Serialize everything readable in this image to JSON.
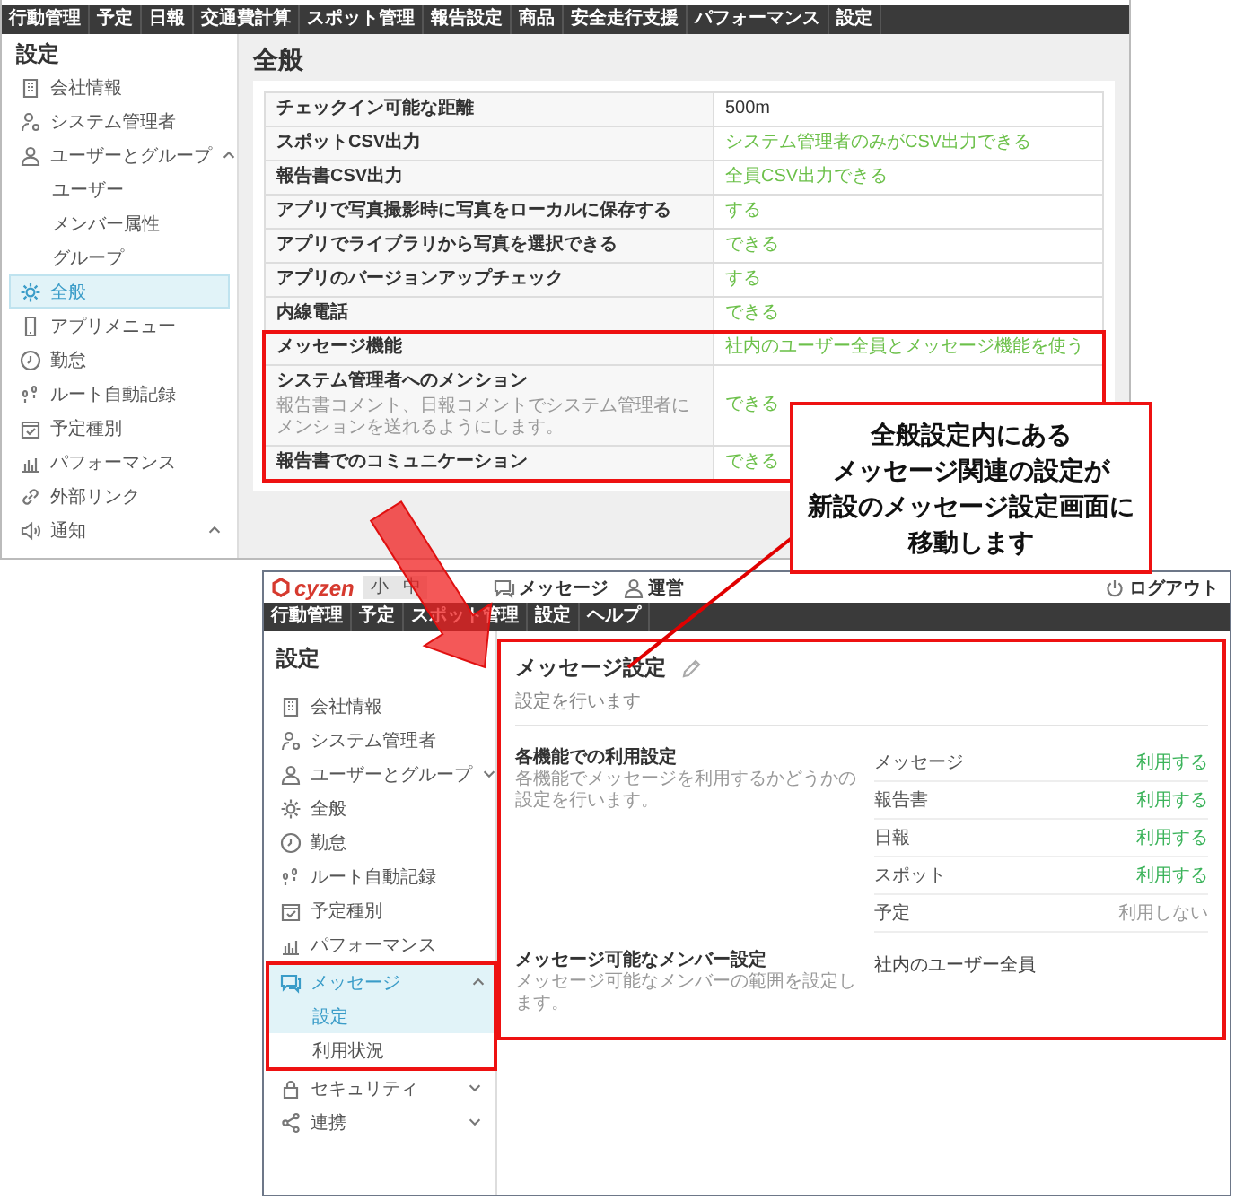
{
  "old_window": {
    "nav_tabs": [
      "行動管理",
      "予定",
      "日報",
      "交通費計算",
      "スポット管理",
      "報告設定",
      "商品",
      "安全走行支援",
      "パフォーマンス",
      "設定"
    ],
    "sidebar": {
      "title": "設定",
      "items": [
        {
          "label": "会社情報",
          "selected": false
        },
        {
          "label": "システム管理者",
          "selected": false
        },
        {
          "label": "ユーザーとグループ",
          "selected": false,
          "expanded": true,
          "children": [
            {
              "label": "ユーザー"
            },
            {
              "label": "メンバー属性"
            },
            {
              "label": "グループ"
            }
          ]
        },
        {
          "label": "全般",
          "selected": true
        },
        {
          "label": "アプリメニュー",
          "selected": false
        },
        {
          "label": "勤怠",
          "selected": false
        },
        {
          "label": "ルート自動記録",
          "selected": false
        },
        {
          "label": "予定種別",
          "selected": false
        },
        {
          "label": "パフォーマンス",
          "selected": false
        },
        {
          "label": "外部リンク",
          "selected": false
        },
        {
          "label": "通知",
          "selected": false,
          "expanded": true
        }
      ]
    },
    "page_title": "全般",
    "table": {
      "rows": [
        {
          "label": "チェックイン可能な距離",
          "value": "500m",
          "color": "#333333"
        },
        {
          "label": "スポットCSV出力",
          "value": "システム管理者のみがCSV出力できる",
          "color": "#6cc04a"
        },
        {
          "label": "報告書CSV出力",
          "value": "全員CSV出力できる",
          "color": "#6cc04a"
        },
        {
          "label": "アプリで写真撮影時に写真をローカルに保存する",
          "value": "する",
          "color": "#6cc04a"
        },
        {
          "label": "アプリでライブラリから写真を選択できる",
          "value": "できる",
          "color": "#6cc04a"
        },
        {
          "label": "アプリのバージョンアップチェック",
          "value": "する",
          "color": "#6cc04a"
        },
        {
          "label": "内線電話",
          "value": "できる",
          "color": "#6cc04a"
        }
      ],
      "highlighted_rows": [
        {
          "label": "メッセージ機能",
          "value": "社内のユーザー全員とメッセージ機能を使う",
          "color": "#6cc04a"
        },
        {
          "label": "システム管理者へのメンション",
          "note": "報告書コメント、日報コメントでシステム管理者にメンションを送れるようにします。",
          "value": "できる",
          "color": "#6cc04a"
        },
        {
          "label": "報告書でのコミュニケーション",
          "value": "できる",
          "color": "#6cc04a"
        }
      ]
    }
  },
  "callout": {
    "lines": [
      "全般設定内にある",
      "メッセージ関連の設定が",
      "新設のメッセージ設定画面に",
      "移動します"
    ]
  },
  "new_window": {
    "logo": "cyzen",
    "font_size_buttons": [
      "小",
      "中"
    ],
    "header_links": [
      "メッセージ",
      "運営"
    ],
    "logout": "ログアウト",
    "nav_tabs": [
      "行動管理",
      "予定",
      "スポット管理",
      "設定",
      "ヘルプ"
    ],
    "sidebar": {
      "title": "設定",
      "items": [
        {
          "label": "会社情報",
          "selected": false,
          "highlighted": false
        },
        {
          "label": "システム管理者",
          "selected": false,
          "highlighted": false
        },
        {
          "label": "ユーザーとグループ",
          "selected": false,
          "highlighted": false,
          "expanded": false
        },
        {
          "label": "全般",
          "selected": false,
          "highlighted": false
        },
        {
          "label": "勤怠",
          "selected": false,
          "highlighted": false
        },
        {
          "label": "ルート自動記録",
          "selected": false,
          "highlighted": false
        },
        {
          "label": "予定種別",
          "selected": false,
          "highlighted": false
        },
        {
          "label": "パフォーマンス",
          "selected": false,
          "highlighted": false
        },
        {
          "label": "メッセージ",
          "selected": true,
          "highlighted": true,
          "expanded": true,
          "children": [
            {
              "label": "設定",
              "selected": true
            },
            {
              "label": "利用状況",
              "selected": false
            }
          ]
        },
        {
          "label": "セキュリティ",
          "selected": false,
          "highlighted": false,
          "expanded": false
        },
        {
          "label": "連携",
          "selected": false,
          "highlighted": false,
          "expanded": false
        }
      ]
    },
    "page_title": "メッセージ設定",
    "page_subtitle": "設定を行います",
    "sections": [
      {
        "title": "各機能での利用設定",
        "description": "各機能でメッセージを利用するかどうかの設定を行います。",
        "rows": [
          {
            "label": "メッセージ",
            "value": "利用する",
            "enabled": true
          },
          {
            "label": "報告書",
            "value": "利用する",
            "enabled": true
          },
          {
            "label": "日報",
            "value": "利用する",
            "enabled": true
          },
          {
            "label": "スポット",
            "value": "利用する",
            "enabled": true
          },
          {
            "label": "予定",
            "value": "利用しない",
            "enabled": false
          }
        ]
      },
      {
        "title": "メッセージ可能なメンバー設定",
        "description": "メッセージ可能なメンバーの範囲を設定します。",
        "rows": [
          {
            "value": "社内のユーザー全員"
          }
        ]
      }
    ]
  }
}
